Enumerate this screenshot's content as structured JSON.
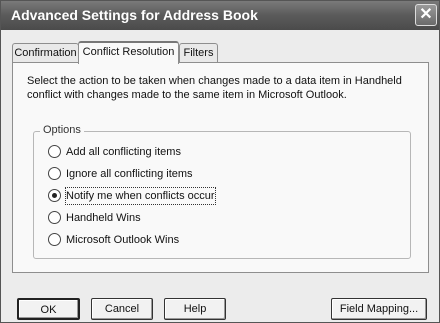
{
  "window": {
    "title": "Advanced Settings for Address Book",
    "close_glyph": "✕"
  },
  "tabs": [
    {
      "label": "Confirmation",
      "active": false
    },
    {
      "label": "Conflict Resolution",
      "active": true
    },
    {
      "label": "Filters",
      "active": false
    }
  ],
  "description": "Select the action to be taken when changes made to a data item in Handheld conflict with changes made to the same item in Microsoft Outlook.",
  "options": {
    "group_label": "Options",
    "items": [
      {
        "label": "Add all conflicting items",
        "checked": false
      },
      {
        "label": "Ignore all conflicting items",
        "checked": false
      },
      {
        "label": "Notify me when conflicts occur",
        "checked": true
      },
      {
        "label": "Handheld Wins",
        "checked": false
      },
      {
        "label": "Microsoft Outlook Wins",
        "checked": false
      }
    ]
  },
  "buttons": {
    "ok": "OK",
    "cancel": "Cancel",
    "help": "Help",
    "field_mapping": "Field Mapping..."
  }
}
